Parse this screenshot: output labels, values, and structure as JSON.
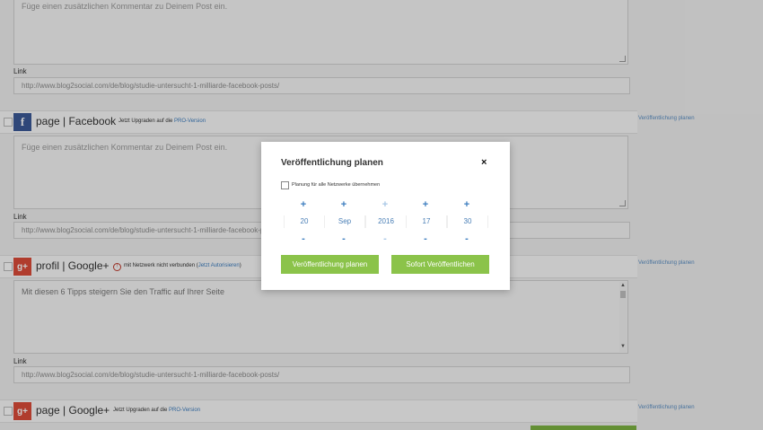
{
  "top_section": {
    "comment_placeholder": "Füge einen zusätzlichen Kommentar zu Deinem Post ein.",
    "link_label": "Link",
    "link_value": "http://www.blog2social.com/de/blog/studie-untersucht-1-milliarde-facebook-posts/"
  },
  "networks": [
    {
      "name": "page | Facebook",
      "icon": "facebook-icon",
      "note_text": "Jetzt Upgraden auf die ",
      "note_link": "PRO-Version",
      "plan_link": "Veröffentlichung planen",
      "comment_placeholder": "Füge einen zusätzlichen Kommentar zu Deinem Post ein.",
      "link_label": "Link",
      "link_value": "http://www.blog2social.com/de/blog/studie-untersucht-1-milliarde-facebook-posts/"
    },
    {
      "name": "profil | Google+",
      "icon": "google-plus-icon",
      "note_text": "mit Netzwerk nicht verbunden (",
      "note_link": "Jetzt Autorisieren",
      "note_suffix": ")",
      "plan_link": "Veröffentlichung planen",
      "comment_value": "Mit diesen 6 Tipps steigern Sie den Traffic auf Ihrer Seite",
      "link_label": "Link",
      "link_value": "http://www.blog2social.com/de/blog/studie-untersucht-1-milliarde-facebook-posts/"
    },
    {
      "name": "page | Google+",
      "icon": "google-plus-icon",
      "note_text": "Jetzt Upgraden auf die ",
      "note_link": "PRO-Version",
      "plan_link": "Veröffentlichung planen"
    }
  ],
  "modal": {
    "title": "Veröffentlichung planen",
    "close_glyph": "×",
    "apply_all_label": "Planung für alle Netzwerke übernehmen",
    "plus_glyph": "+",
    "minus_glyph": "-",
    "fields": [
      {
        "value": "20"
      },
      {
        "value": "Sep"
      },
      {
        "value": "2016"
      },
      {
        "value": "17"
      },
      {
        "value": "30"
      }
    ],
    "schedule_button": "Veröffentlichung planen",
    "publish_now_button": "Sofort Veröffentlichen"
  },
  "colors": {
    "accent_green": "#8bc34a",
    "link_blue": "#3c7dbf",
    "facebook_blue": "#3b5998",
    "google_red": "#dd4b39"
  },
  "glyphs": {
    "facebook": "f",
    "google_plus": "g+",
    "warning": "!",
    "scroll_up": "▲",
    "scroll_down": "▼"
  }
}
